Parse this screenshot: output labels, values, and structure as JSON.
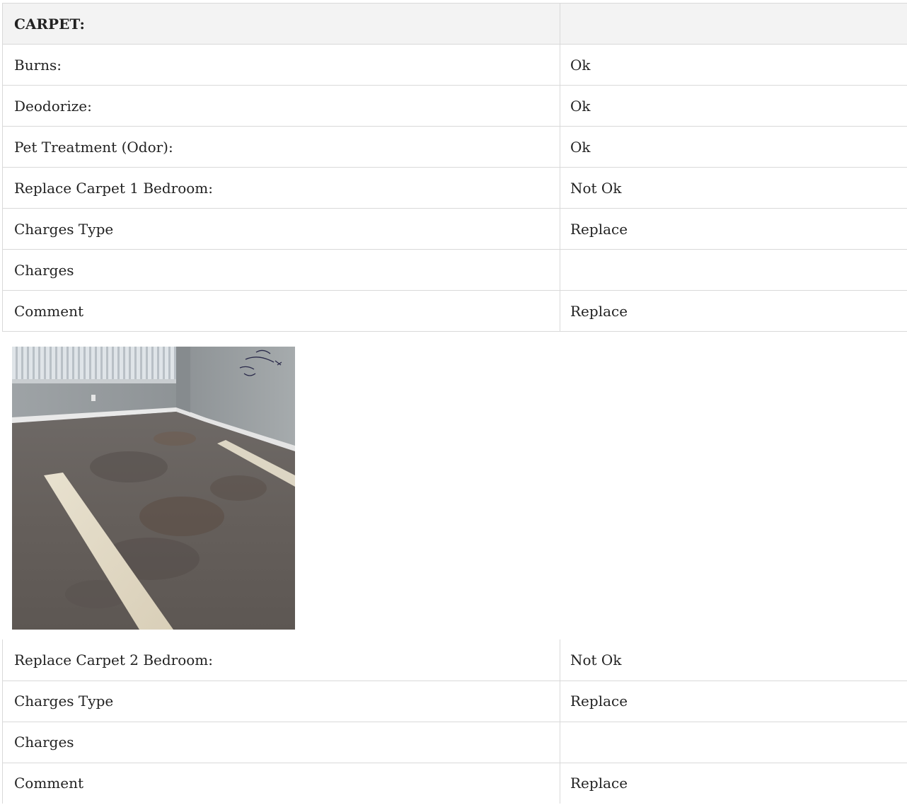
{
  "section_header": {
    "label": "CARPET:",
    "value": ""
  },
  "rows_top": [
    {
      "label": "Burns:",
      "value": "Ok"
    },
    {
      "label": "Deodorize:",
      "value": "Ok"
    },
    {
      "label": "Pet Treatment (Odor):",
      "value": "Ok"
    },
    {
      "label": "Replace Carpet 1 Bedroom:",
      "value": "Not Ok"
    },
    {
      "label": "Charges Type",
      "value": "Replace"
    },
    {
      "label": "Charges",
      "value": ""
    },
    {
      "label": "Comment",
      "value": "Replace"
    }
  ],
  "rows_bottom": [
    {
      "label": "Replace Carpet 2 Bedroom:",
      "value": "Not Ok"
    },
    {
      "label": "Charges Type",
      "value": "Replace"
    },
    {
      "label": "Charges",
      "value": ""
    },
    {
      "label": "Comment",
      "value": "Replace"
    }
  ]
}
